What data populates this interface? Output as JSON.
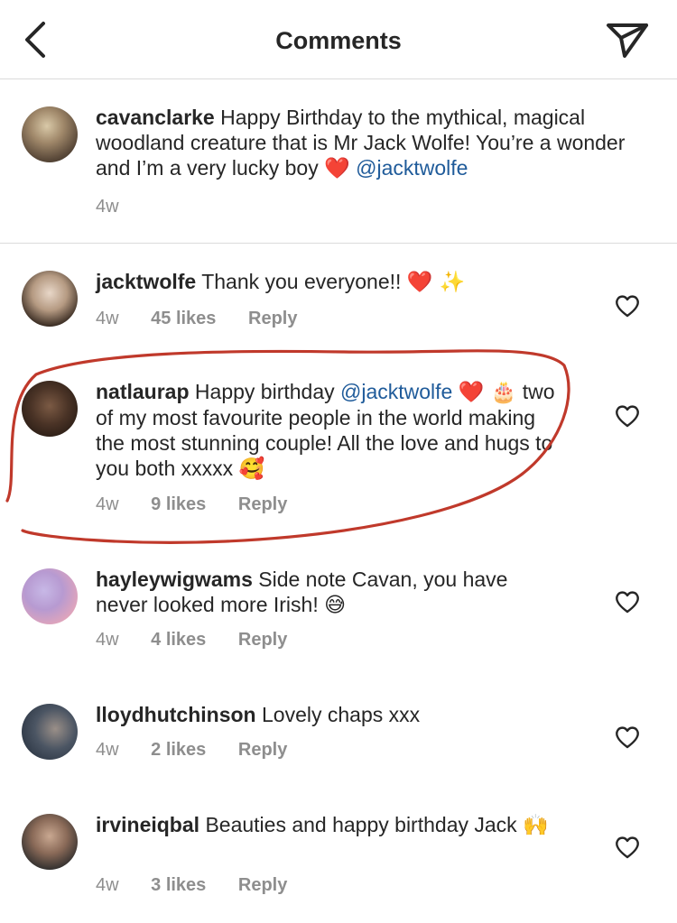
{
  "header": {
    "title": "Comments"
  },
  "caption": {
    "username": "cavanclarke",
    "text": "Happy Birthday to the mythical, magical woodland creature that is Mr Jack Wolfe! You’re a wonder and I’m a very lucky boy",
    "emoji": "❤️",
    "mention": "@jacktwolfe",
    "time": "4w"
  },
  "comments": [
    {
      "username": "jacktwolfe",
      "text": "Thank you everyone!!",
      "emoji": "❤️ ✨",
      "time": "4w",
      "likes": "45 likes",
      "reply": "Reply"
    },
    {
      "username": "natlaurap",
      "text_pre": "Happy birthday",
      "mention": "@jacktwolfe",
      "emoji1": "❤️ 🎂",
      "text_post": "two of my most favourite people in the world making the most stunning couple! All the love and hugs to you both xxxxx",
      "emoji2": "🥰",
      "time": "4w",
      "likes": "9 likes",
      "reply": "Reply"
    },
    {
      "username": "hayleywigwams",
      "text": "Side note Cavan, you have never looked more Irish!",
      "emoji": "😅",
      "time": "4w",
      "likes": "4 likes",
      "reply": "Reply"
    },
    {
      "username": "lloydhutchinson",
      "text": "Lovely chaps xxx",
      "time": "4w",
      "likes": "2 likes",
      "reply": "Reply"
    },
    {
      "username": "irvineiqbal",
      "text": "Beauties and happy birthday Jack",
      "emoji": "🙌",
      "time": "4w",
      "likes": "3 likes",
      "reply": "Reply"
    }
  ],
  "colors": {
    "mention": "#1f5b9a",
    "meta": "#8e8e8e",
    "divider": "#dbdbdb",
    "annotation": "#c0392b"
  }
}
